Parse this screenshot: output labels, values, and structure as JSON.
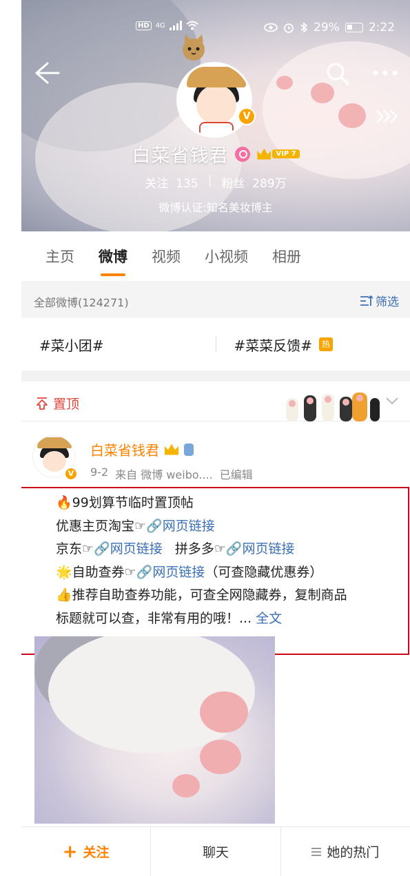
{
  "status_bar": {
    "network": "4G",
    "hd": "HD",
    "battery": "29%",
    "time": "2:22"
  },
  "profile": {
    "name": "白菜省钱君",
    "vip_label": "VIP 7",
    "following_label": "关注",
    "following_count": "135",
    "separator": "|",
    "fans_label": "粉丝",
    "fans_count": "289万",
    "verification": "微博认证:知名美妆博主",
    "verified_badge": "V"
  },
  "tabs": [
    {
      "label": "主页",
      "active": false
    },
    {
      "label": "微博",
      "active": true
    },
    {
      "label": "视频",
      "active": false
    },
    {
      "label": "小视频",
      "active": false
    },
    {
      "label": "相册",
      "active": false
    }
  ],
  "filter_bar": {
    "count_text": "全部微博(124271)",
    "filter_label": "筛选"
  },
  "topics": [
    {
      "label": "#菜小团#"
    },
    {
      "label": "#菜菜反馈#",
      "badge": "热"
    }
  ],
  "pinned": {
    "label": "置顶"
  },
  "post": {
    "author": "白菜省钱君",
    "verified_badge": "V",
    "date": "9-2",
    "source": "来自 微博 weibo....",
    "edited": "已编辑",
    "lines": {
      "l1": "🔥99划算节临时置顶帖",
      "l2_prefix": "优惠主页淘宝☞",
      "l2_link": "🔗网页链接",
      "l3_prefix": "京东☞",
      "l3_link1": "🔗网页链接",
      "l3_mid": "拼多多☞",
      "l3_link2": "🔗网页链接",
      "l4_prefix": "🌟自助查券☞",
      "l4_link": "🔗网页链接",
      "l4_suffix": "（可查隐藏优惠券）",
      "l5": "👍推荐自助查券功能，可查全网隐藏券，复制商品",
      "l6": "标题就可以查，非常有用的哦！...",
      "full_text": "全文"
    }
  },
  "bottom_bar": {
    "follow_label": "关注",
    "chat_label": "聊天",
    "hot_label": "她的热门"
  },
  "colors": {
    "accent": "#ff8200",
    "link": "#3b6fb5",
    "pinned": "#e0463b",
    "highlight_box": "#d0021b"
  }
}
